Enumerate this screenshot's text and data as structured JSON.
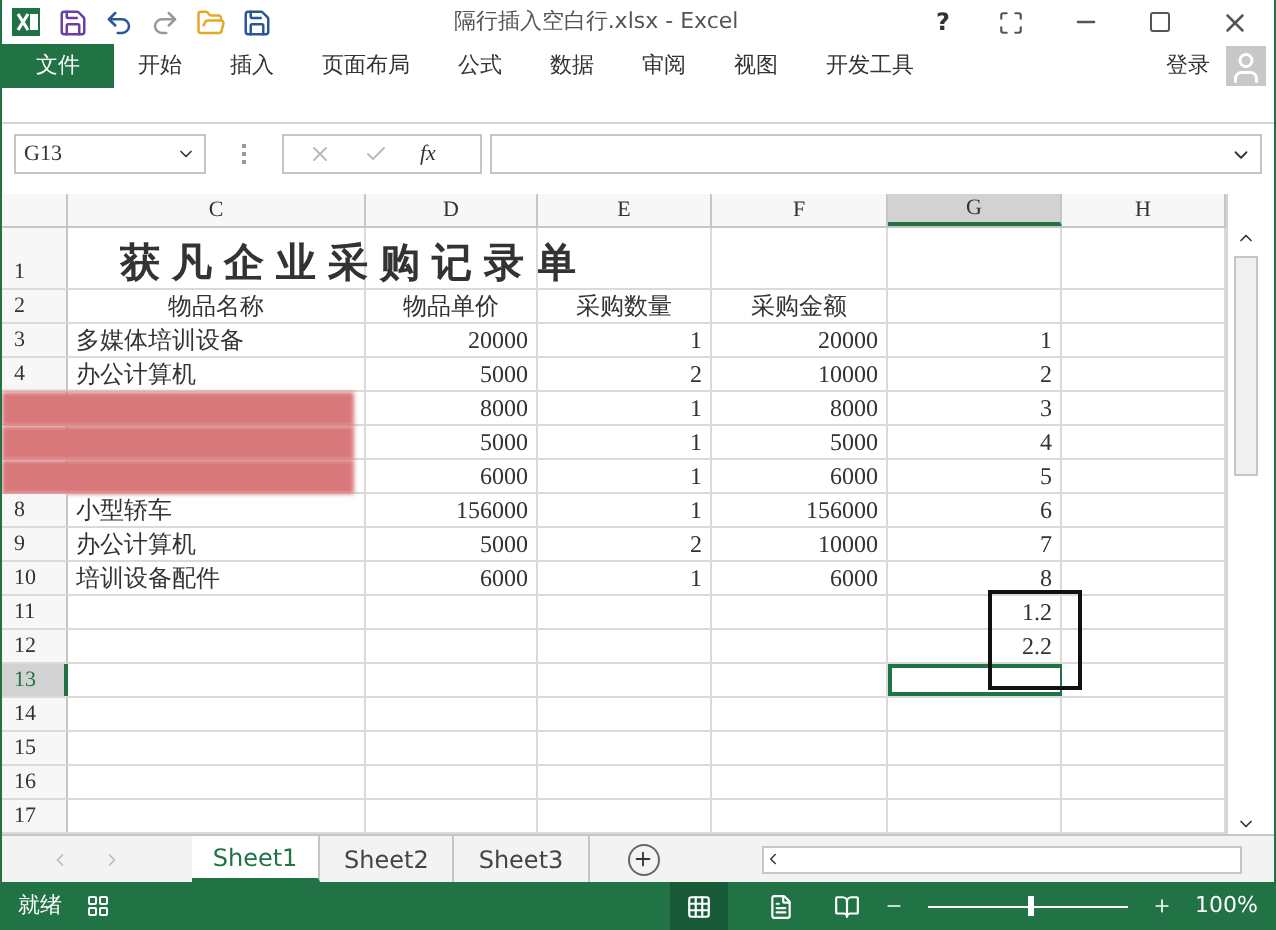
{
  "title_bar": {
    "title": "隔行插入空白行.xlsx - Excel",
    "help": "?"
  },
  "ribbon_tabs": [
    {
      "label": "文件",
      "kind": "file"
    },
    {
      "label": "开始",
      "kind": "tab"
    },
    {
      "label": "插入",
      "kind": "tab"
    },
    {
      "label": "页面布局",
      "kind": "tab"
    },
    {
      "label": "公式",
      "kind": "tab"
    },
    {
      "label": "数据",
      "kind": "tab"
    },
    {
      "label": "审阅",
      "kind": "tab"
    },
    {
      "label": "视图",
      "kind": "tab"
    },
    {
      "label": "开发工具",
      "kind": "tab"
    }
  ],
  "account": {
    "label": "登录"
  },
  "formula_bar": {
    "name_box": "G13",
    "function_label": "fx"
  },
  "columns": [
    {
      "label": "C",
      "selected": false
    },
    {
      "label": "D",
      "selected": false
    },
    {
      "label": "E",
      "selected": false
    },
    {
      "label": "F",
      "selected": false
    },
    {
      "label": "G",
      "selected": true
    },
    {
      "label": "H",
      "selected": false
    }
  ],
  "rows": [
    {
      "number": "1",
      "kind": "title",
      "selected": false,
      "redacted": false,
      "cells": {
        "C": "获凡企业采购记录单"
      }
    },
    {
      "number": "2",
      "kind": "header",
      "selected": false,
      "redacted": false,
      "cells": {
        "C": "物品名称",
        "D": "物品单价",
        "E": "采购数量",
        "F": "采购金额"
      }
    },
    {
      "number": "3",
      "kind": "data",
      "selected": false,
      "redacted": false,
      "cells": {
        "C": "多媒体培训设备",
        "D": "20000",
        "E": "1",
        "F": "20000",
        "G": "1"
      }
    },
    {
      "number": "4",
      "kind": "data",
      "selected": false,
      "redacted": false,
      "cells": {
        "C": "办公计算机",
        "D": "5000",
        "E": "2",
        "F": "10000",
        "G": "2"
      }
    },
    {
      "kind": "data",
      "selected": false,
      "redacted": true,
      "cells": {
        "D": "8000",
        "E": "1",
        "F": "8000",
        "G": "3"
      }
    },
    {
      "kind": "data",
      "selected": false,
      "redacted": true,
      "cells": {
        "D": "5000",
        "E": "1",
        "F": "5000",
        "G": "4"
      }
    },
    {
      "kind": "data",
      "selected": false,
      "redacted": true,
      "cells": {
        "D": "6000",
        "E": "1",
        "F": "6000",
        "G": "5"
      }
    },
    {
      "number": "8",
      "kind": "data",
      "selected": false,
      "redacted": false,
      "cells": {
        "C": "小型轿车",
        "D": "156000",
        "E": "1",
        "F": "156000",
        "G": "6"
      }
    },
    {
      "number": "9",
      "kind": "data",
      "selected": false,
      "redacted": false,
      "cells": {
        "C": "办公计算机",
        "D": "5000",
        "E": "2",
        "F": "10000",
        "G": "7"
      }
    },
    {
      "number": "10",
      "kind": "data",
      "selected": false,
      "redacted": false,
      "cells": {
        "C": "培训设备配件",
        "D": "6000",
        "E": "1",
        "F": "6000",
        "G": "8"
      }
    },
    {
      "number": "11",
      "kind": "data",
      "selected": false,
      "redacted": false,
      "cells": {
        "G": "1.2"
      }
    },
    {
      "number": "12",
      "kind": "data",
      "selected": false,
      "redacted": false,
      "cells": {
        "G": "2.2"
      }
    },
    {
      "number": "13",
      "kind": "data",
      "selected": true,
      "redacted": false,
      "cells": {}
    },
    {
      "number": "14",
      "kind": "data",
      "selected": false,
      "redacted": false,
      "cells": {}
    },
    {
      "number": "15",
      "kind": "data",
      "selected": false,
      "redacted": false,
      "cells": {}
    },
    {
      "number": "16",
      "kind": "data",
      "selected": false,
      "redacted": false,
      "cells": {}
    },
    {
      "number": "17",
      "kind": "data",
      "selected": false,
      "redacted": false,
      "cells": {}
    }
  ],
  "sheet_tabs": [
    {
      "label": "Sheet1",
      "selected": true
    },
    {
      "label": "Sheet2",
      "selected": false
    },
    {
      "label": "Sheet3",
      "selected": false
    }
  ],
  "status_bar": {
    "status": "就绪",
    "zoom": "100%",
    "zoom_level": {
      "level": 0.5
    }
  }
}
